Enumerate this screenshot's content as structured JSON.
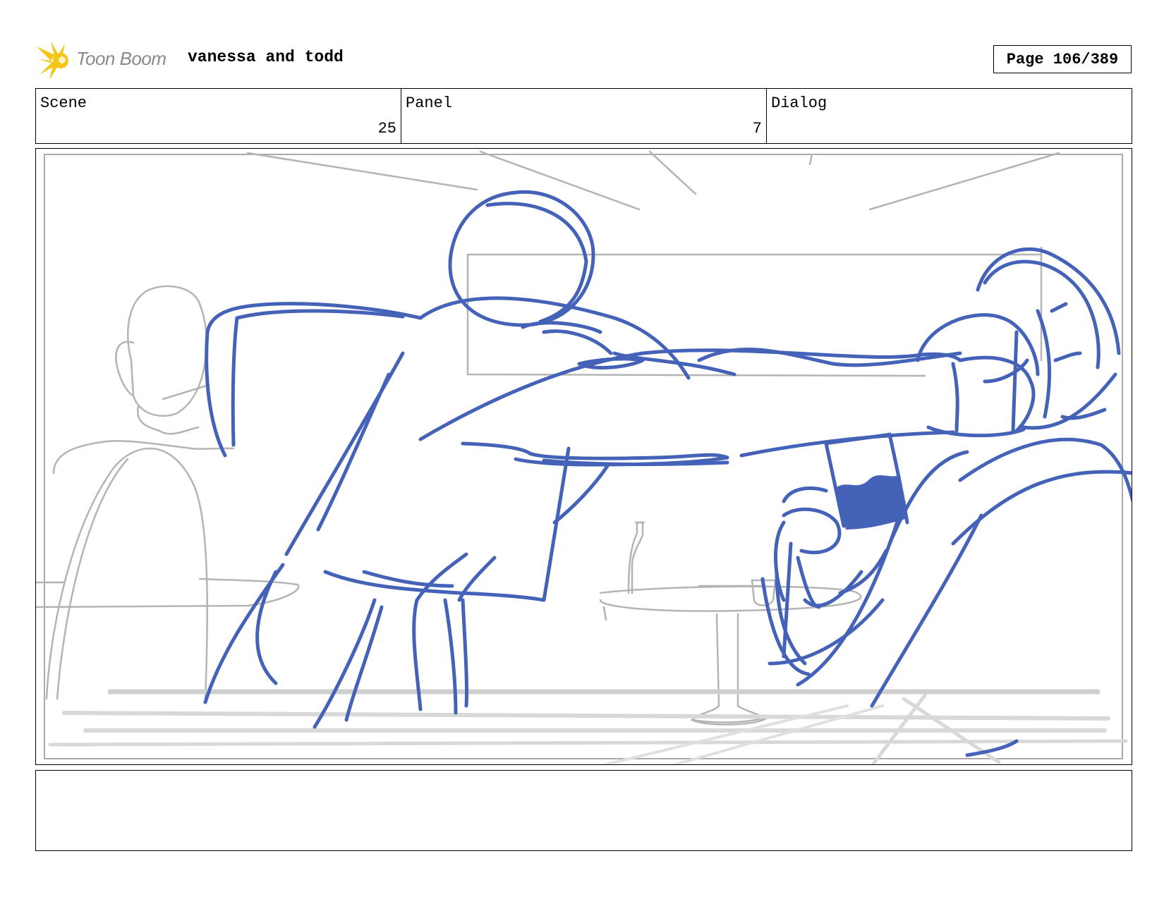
{
  "header": {
    "logo_text": "Toon Boom",
    "project_title": "vanessa and todd",
    "page_label": "Page 106/389"
  },
  "info": {
    "scene_label": "Scene",
    "scene_value": "25",
    "panel_label": "Panel",
    "panel_value": "7",
    "dialog_label": "Dialog",
    "dialog_value": ""
  },
  "notes": {
    "text": ""
  },
  "colors": {
    "sketch_blue": "#4462b8",
    "sketch_gray": "#b4b4b4",
    "logo_yellow": "#f5c518"
  }
}
